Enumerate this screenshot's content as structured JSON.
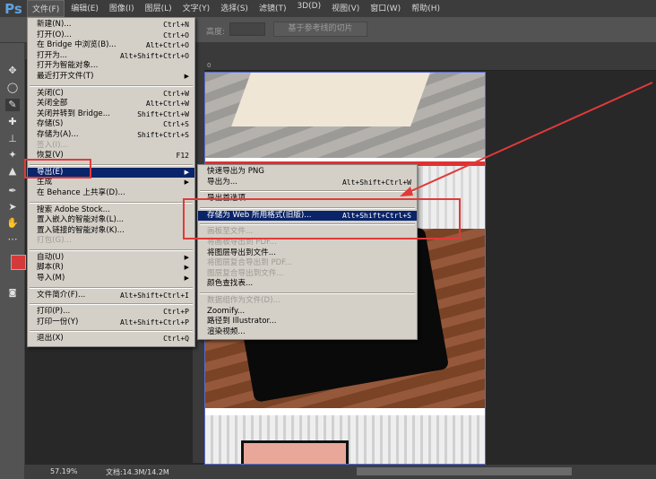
{
  "app": {
    "logo": "Ps"
  },
  "menubar": [
    "文件(F)",
    "编辑(E)",
    "图像(I)",
    "图层(L)",
    "文字(Y)",
    "选择(S)",
    "滤镜(T)",
    "3D(D)",
    "视图(V)",
    "窗口(W)",
    "帮助(H)"
  ],
  "options": {
    "height_label": "高度:",
    "slice_button": "基于参考线的切片"
  },
  "file_menu": [
    {
      "label": "新建(N)...",
      "shortcut": "Ctrl+N"
    },
    {
      "label": "打开(O)...",
      "shortcut": "Ctrl+O"
    },
    {
      "label": "在 Bridge 中浏览(B)...",
      "shortcut": "Alt+Ctrl+O"
    },
    {
      "label": "打开为...",
      "shortcut": "Alt+Shift+Ctrl+O"
    },
    {
      "label": "打开为智能对象..."
    },
    {
      "label": "最近打开文件(T)",
      "submenu": true
    },
    {
      "sep": true
    },
    {
      "label": "关闭(C)",
      "shortcut": "Ctrl+W"
    },
    {
      "label": "关闭全部",
      "shortcut": "Alt+Ctrl+W"
    },
    {
      "label": "关闭并转到 Bridge...",
      "shortcut": "Shift+Ctrl+W"
    },
    {
      "label": "存储(S)",
      "shortcut": "Ctrl+S"
    },
    {
      "label": "存储为(A)...",
      "shortcut": "Shift+Ctrl+S"
    },
    {
      "label": "签入(I)...",
      "disabled": true
    },
    {
      "label": "恢复(V)",
      "shortcut": "F12"
    },
    {
      "sep": true
    },
    {
      "label": "导出(E)",
      "submenu": true,
      "highlighted": true
    },
    {
      "label": "生成",
      "submenu": true
    },
    {
      "label": "在 Behance 上共享(D)..."
    },
    {
      "sep": true
    },
    {
      "label": "搜索 Adobe Stock..."
    },
    {
      "label": "置入嵌入的智能对象(L)..."
    },
    {
      "label": "置入链接的智能对象(K)..."
    },
    {
      "label": "打包(G)...",
      "disabled": true
    },
    {
      "sep": true
    },
    {
      "label": "自动(U)",
      "submenu": true
    },
    {
      "label": "脚本(R)",
      "submenu": true
    },
    {
      "label": "导入(M)",
      "submenu": true
    },
    {
      "sep": true
    },
    {
      "label": "文件简介(F)...",
      "shortcut": "Alt+Shift+Ctrl+I"
    },
    {
      "sep": true
    },
    {
      "label": "打印(P)...",
      "shortcut": "Ctrl+P"
    },
    {
      "label": "打印一份(Y)",
      "shortcut": "Alt+Shift+Ctrl+P"
    },
    {
      "sep": true
    },
    {
      "label": "退出(X)",
      "shortcut": "Ctrl+Q"
    }
  ],
  "export_menu": [
    {
      "label": "快速导出为 PNG"
    },
    {
      "label": "导出为...",
      "shortcut": "Alt+Shift+Ctrl+W"
    },
    {
      "sep": true
    },
    {
      "label": "导出首选项..."
    },
    {
      "sep": true
    },
    {
      "label": "存储为 Web 所用格式(旧版)...",
      "shortcut": "Alt+Shift+Ctrl+S",
      "highlighted": true
    },
    {
      "sep": true
    },
    {
      "label": "画板至文件...",
      "disabled": true
    },
    {
      "label": "将画板导出到 PDF...",
      "disabled": true
    },
    {
      "label": "将图层导出到文件..."
    },
    {
      "label": "将图层复合导出到 PDF...",
      "disabled": true
    },
    {
      "label": "图层复合导出到文件...",
      "disabled": true
    },
    {
      "label": "颜色查找表..."
    },
    {
      "sep": true
    },
    {
      "label": "数据组作为文件(D)...",
      "disabled": true
    },
    {
      "label": "Zoomify..."
    },
    {
      "label": "路径到 Illustrator..."
    },
    {
      "label": "渲染视频..."
    }
  ],
  "status": {
    "zoom": "57.19%",
    "doc": "文档:14.3M/14.2M"
  },
  "colors": {
    "foreground": "#d43a3a",
    "highlight": "#0a246a",
    "annotation": "#e03a3a"
  }
}
